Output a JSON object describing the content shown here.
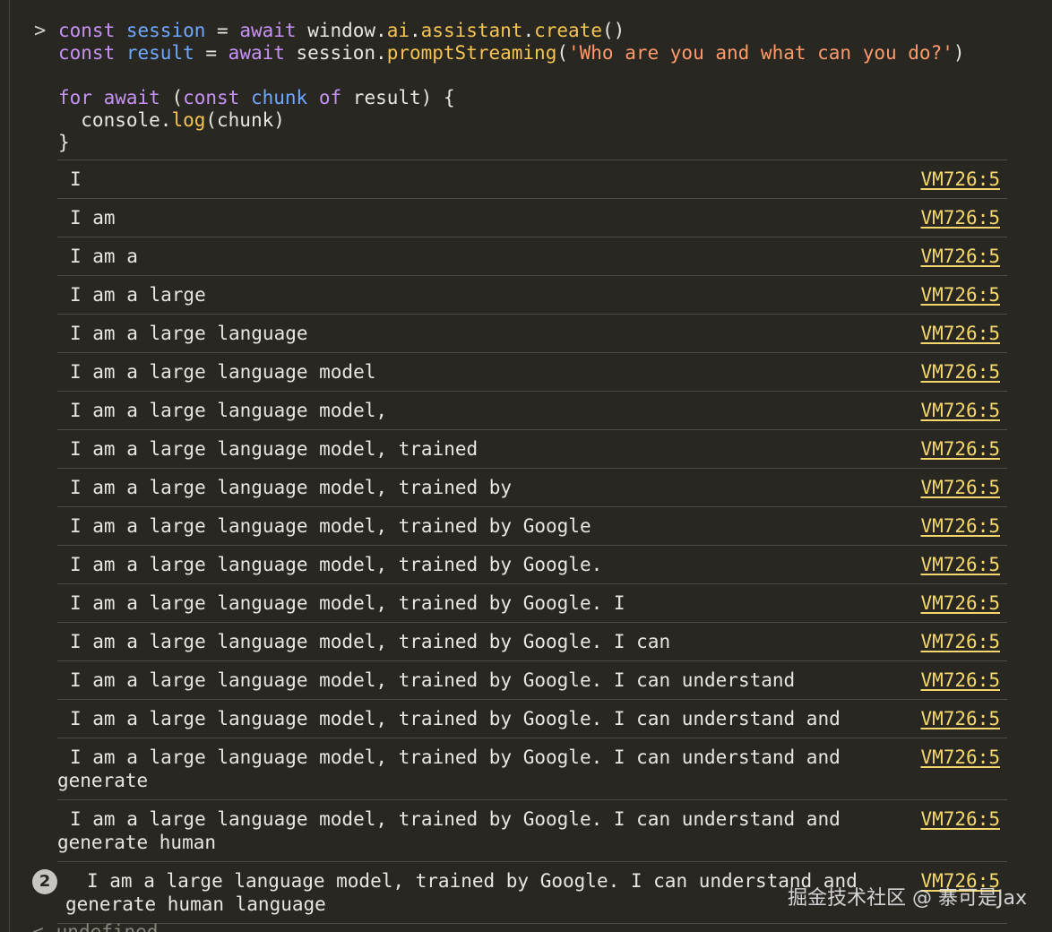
{
  "prompt_symbol": ">",
  "code": {
    "line1": {
      "kw1": "const",
      "var1": "session",
      "eq": " = ",
      "kw2": "await",
      "obj": " window.",
      "prop1": "ai",
      "dot1": ".",
      "prop2": "assistant",
      "dot2": ".",
      "fn": "create",
      "rest": "()"
    },
    "line2": {
      "kw1": "const",
      "var1": "result",
      "eq": " = ",
      "kw2": "await",
      "obj": " session.",
      "fn": "promptStreaming",
      "open": "(",
      "str": "'Who are you and what can you do?'",
      "close": ")"
    },
    "line4": {
      "kw1": "for",
      "kw2": "await",
      "open": " (",
      "kw3": "const",
      "var1": "chunk",
      "kw4": "of",
      "rest": " result) {"
    },
    "line5": {
      "obj": "  console.",
      "fn": "log",
      "rest": "(chunk)"
    },
    "line6": "}"
  },
  "logs": [
    {
      "text": "I",
      "source": "VM726:5"
    },
    {
      "text": "I am",
      "source": "VM726:5"
    },
    {
      "text": "I am a",
      "source": "VM726:5"
    },
    {
      "text": "I am a large",
      "source": "VM726:5"
    },
    {
      "text": "I am a large language",
      "source": "VM726:5"
    },
    {
      "text": "I am a large language model",
      "source": "VM726:5"
    },
    {
      "text": "I am a large language model,",
      "source": "VM726:5"
    },
    {
      "text": "I am a large language model, trained",
      "source": "VM726:5"
    },
    {
      "text": "I am a large language model, trained by",
      "source": "VM726:5"
    },
    {
      "text": "I am a large language model, trained by Google",
      "source": "VM726:5"
    },
    {
      "text": "I am a large language model, trained by Google.",
      "source": "VM726:5"
    },
    {
      "text": "I am a large language model, trained by Google. I",
      "source": "VM726:5"
    },
    {
      "text": "I am a large language model, trained by Google. I can",
      "source": "VM726:5"
    },
    {
      "text": "I am a large language model, trained by Google. I can understand",
      "source": "VM726:5"
    },
    {
      "text": "I am a large language model, trained by Google. I can understand and",
      "source": "VM726:5"
    },
    {
      "text": "I am a large language model, trained by Google. I can understand and generate",
      "source": "VM726:5"
    },
    {
      "text": "I am a large language model, trained by Google. I can understand and generate human",
      "source": "VM726:5"
    },
    {
      "text": "I am a large language model, trained by Google. I can understand and generate human language",
      "source": "VM726:5",
      "repeat_count": "2"
    }
  ],
  "result": {
    "arrow": "<",
    "value": "undefined"
  },
  "watermark": "掘金技术社区 @ 寨可是Jax"
}
